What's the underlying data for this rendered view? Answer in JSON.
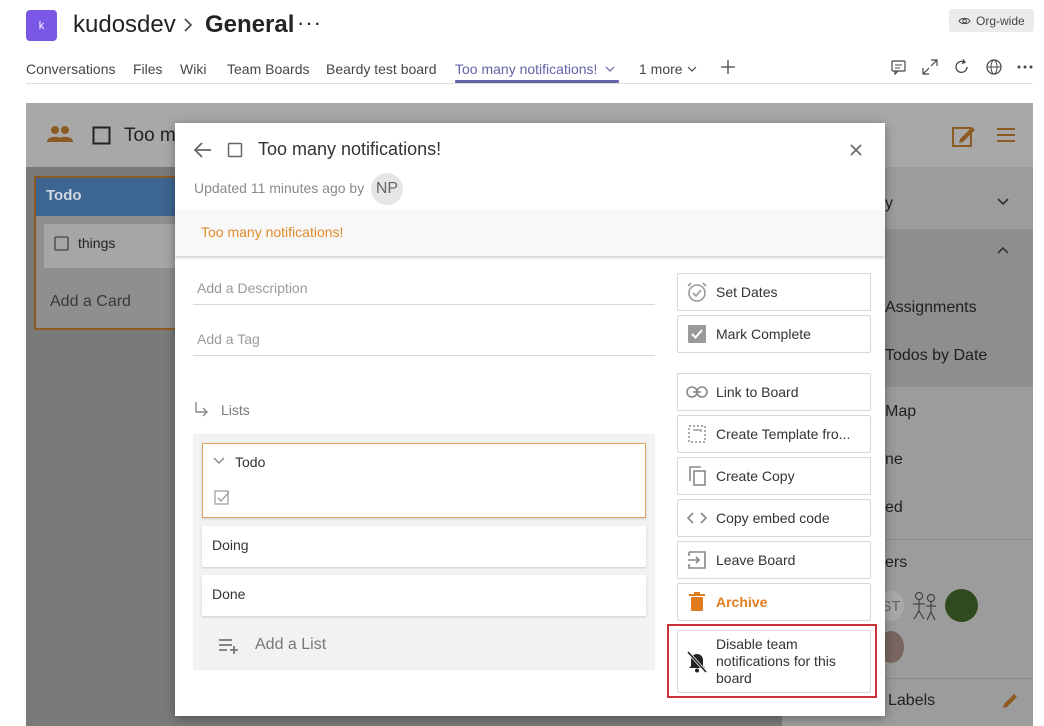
{
  "header": {
    "team_avatar": "k",
    "team_name": "kudosdev",
    "channel_name": "General",
    "more": "···",
    "org_badge": "Org-wide"
  },
  "tabs": [
    {
      "label": "Conversations"
    },
    {
      "label": "Files"
    },
    {
      "label": "Wiki"
    },
    {
      "label": "Team Boards"
    },
    {
      "label": "Beardy test board"
    },
    {
      "label": "Too many notifications!",
      "active": true
    },
    {
      "label": "1 more"
    }
  ],
  "board": {
    "title_partial": "Too m",
    "column_title": "Todo",
    "card": "things",
    "add_card": "Add a Card",
    "side_items": [
      "y",
      "Assignments",
      "Todos by Date",
      "Map",
      "ne",
      "ed",
      "ers",
      "Labels"
    ],
    "side_badge": "ST"
  },
  "modal": {
    "title": "Too many notifications!",
    "updated": "Updated 11 minutes ago by",
    "avatar": "NP",
    "notice": "Too many notifications!",
    "description_placeholder": "Add a Description",
    "tag_placeholder": "Add a Tag",
    "lists_label": "Lists",
    "lists": [
      "Todo",
      "Doing",
      "Done"
    ],
    "add_list": "Add a List",
    "actions": {
      "set_dates": "Set Dates",
      "mark_complete": "Mark Complete",
      "link_to_board": "Link to Board",
      "create_template": "Create Template fro...",
      "create_copy": "Create Copy",
      "copy_embed": "Copy embed code",
      "leave_board": "Leave Board",
      "archive": "Archive",
      "disable_notifications": "Disable team notifications for this board"
    }
  },
  "colors": {
    "teams_accent": "#6264a7",
    "orange": "#e07b20",
    "highlight": "#c8303a"
  }
}
